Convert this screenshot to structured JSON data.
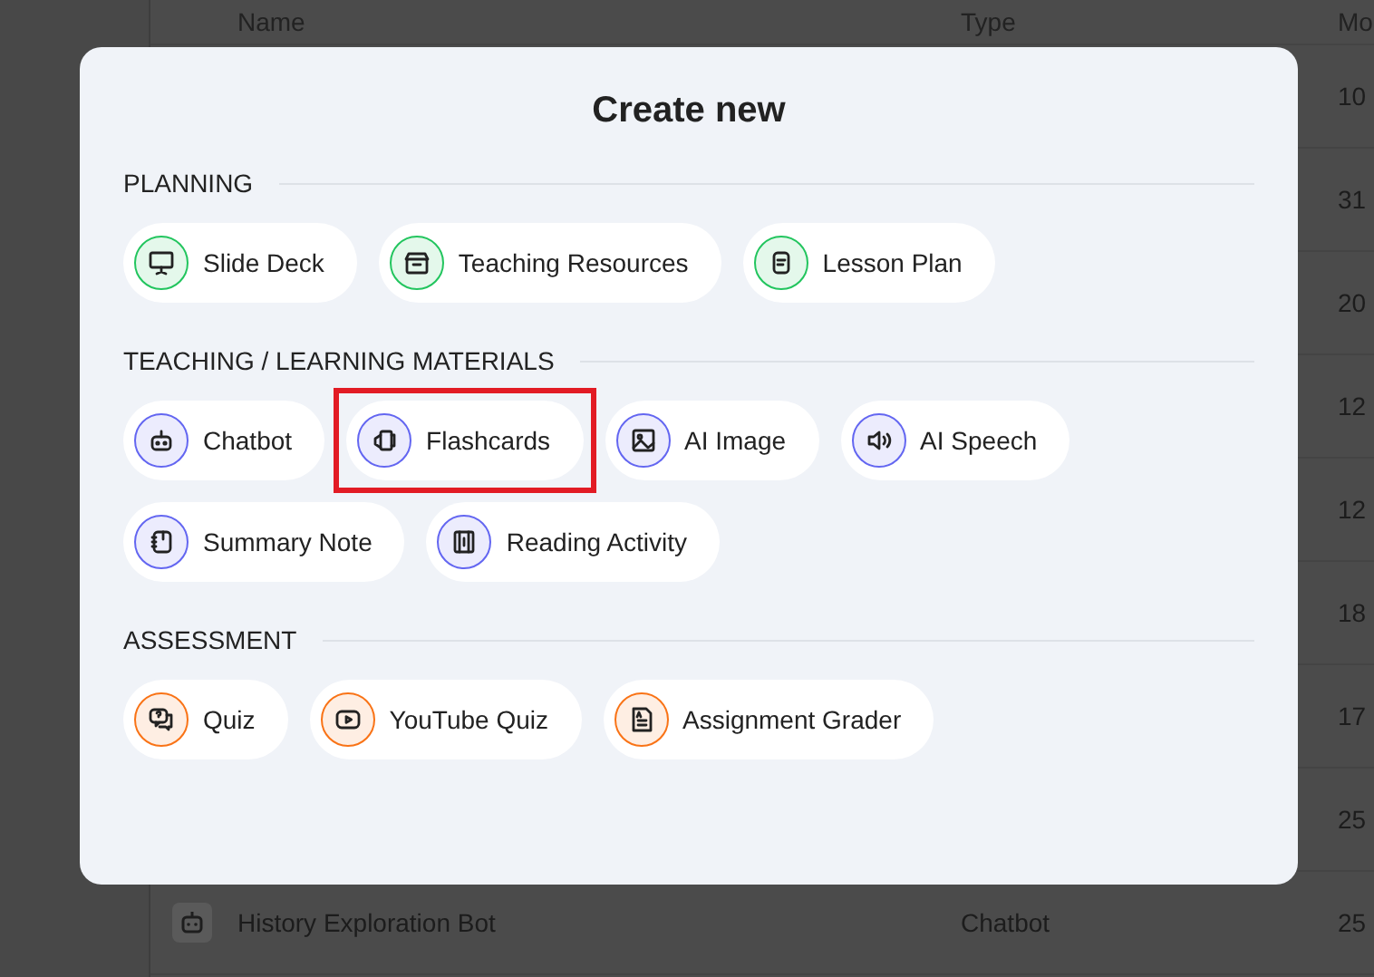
{
  "table": {
    "columns": [
      "Name",
      "Type",
      "Mo"
    ],
    "rows": [
      {
        "name": "",
        "type": "",
        "modified": "10"
      },
      {
        "name": "",
        "type": "",
        "modified": "31"
      },
      {
        "name": "",
        "type": "",
        "modified": "20"
      },
      {
        "name": "",
        "type": "",
        "modified": "12"
      },
      {
        "name": "",
        "type": "",
        "modified": "12"
      },
      {
        "name": "",
        "type": "",
        "modified": "18"
      },
      {
        "name": "",
        "type": "",
        "modified": "17"
      },
      {
        "name": "",
        "type": "",
        "modified": "25"
      },
      {
        "name": "History Exploration Bot",
        "type": "Chatbot",
        "modified": "25"
      }
    ]
  },
  "dialog": {
    "title": "Create new",
    "sections": [
      {
        "label": "PLANNING",
        "color": "#22c55e",
        "items": [
          {
            "label": "Slide Deck",
            "kind": "slides",
            "highlighted": false
          },
          {
            "label": "Teaching Resources",
            "kind": "box",
            "highlighted": false
          },
          {
            "label": "Lesson Plan",
            "kind": "clipboard",
            "highlighted": false
          }
        ]
      },
      {
        "label": "TEACHING / LEARNING MATERIALS",
        "color": "#6366f1",
        "items": [
          {
            "label": "Chatbot",
            "kind": "robot",
            "highlighted": false
          },
          {
            "label": "Flashcards",
            "kind": "cards",
            "highlighted": true
          },
          {
            "label": "AI Image",
            "kind": "image",
            "highlighted": false
          },
          {
            "label": "AI Speech",
            "kind": "speaker",
            "highlighted": false
          },
          {
            "label": "Summary Note",
            "kind": "notebook",
            "highlighted": false
          },
          {
            "label": "Reading Activity",
            "kind": "book",
            "highlighted": false
          }
        ]
      },
      {
        "label": "ASSESSMENT",
        "color": "#f97316",
        "items": [
          {
            "label": "Quiz",
            "kind": "chat",
            "highlighted": false
          },
          {
            "label": "YouTube Quiz",
            "kind": "video",
            "highlighted": false
          },
          {
            "label": "Assignment Grader",
            "kind": "document",
            "highlighted": false
          }
        ]
      }
    ]
  }
}
